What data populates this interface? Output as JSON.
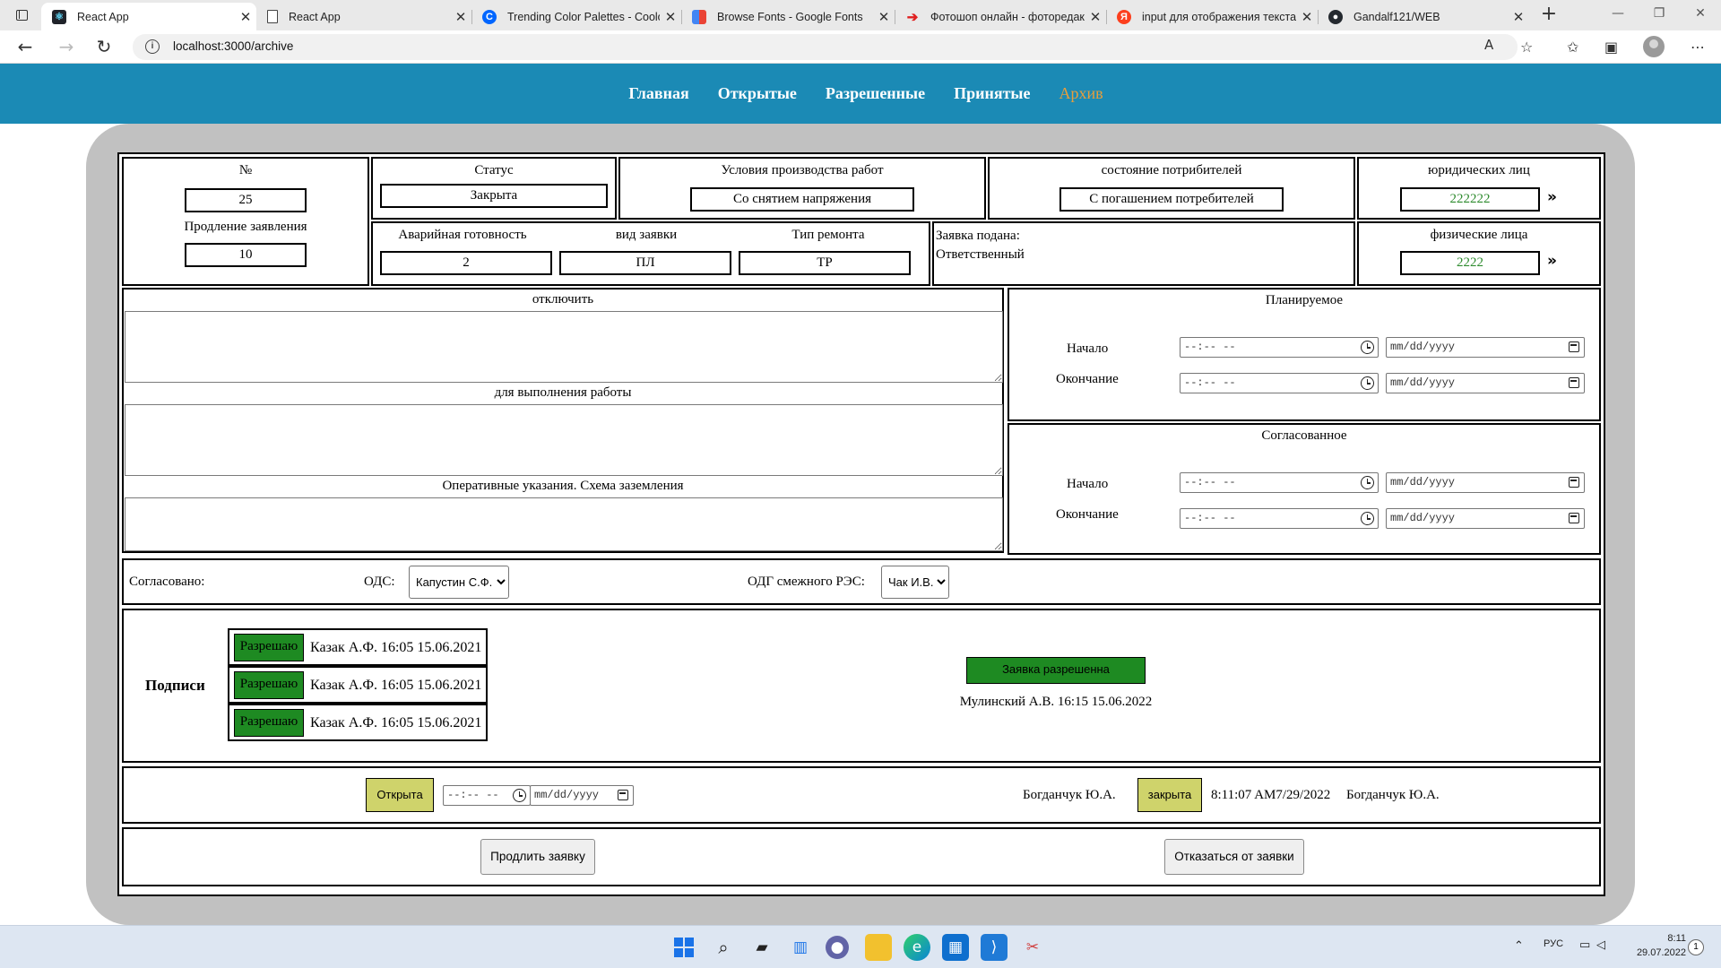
{
  "browser": {
    "tabs": [
      {
        "title": "React App",
        "icon": "react-icon",
        "active": true
      },
      {
        "title": "React App",
        "icon": "page-icon"
      },
      {
        "title": "Trending Color Palettes - Coolors",
        "icon": "coolors-icon"
      },
      {
        "title": "Browse Fonts - Google Fonts",
        "icon": "google-fonts-icon"
      },
      {
        "title": "Фотошоп онлайн - фоторедактор",
        "icon": "photoshop-online-icon"
      },
      {
        "title": "input для отображения текста",
        "icon": "yandex-icon"
      },
      {
        "title": "Gandalf121/WEB",
        "icon": "github-icon"
      }
    ],
    "url": "localhost:3000/archive"
  },
  "nav": {
    "items": [
      "Главная",
      "Открытые",
      "Разрешенные",
      "Принятые",
      "Архив"
    ],
    "active": "Архив",
    "active_color": "#e89e3c",
    "bg_color": "#1b8ab5"
  },
  "form": {
    "number": {
      "label": "№",
      "value": "25"
    },
    "extension": {
      "label": "Продление заявления",
      "value": "10"
    },
    "status": {
      "label": "Статус",
      "value": "Закрыта"
    },
    "conditions": {
      "label": "Условия производства работ",
      "value": "Со снятием напряжения"
    },
    "consumers": {
      "label": "состояние потрибителей",
      "value": "С погашением потребителей"
    },
    "legal": {
      "label": "юридических лиц",
      "value": "222222"
    },
    "physical": {
      "label": "физические лица",
      "value": "2222"
    },
    "emergency": {
      "label": "Аварийная готовность",
      "value": "2"
    },
    "request_type": {
      "label": "вид заявки",
      "value": "ПЛ"
    },
    "repair_type": {
      "label": "Тип ремонта",
      "value": "ТР"
    },
    "submitted_label": "Заявка подана:",
    "responsible_label": "Ответственный",
    "disconnect_label": "отключить",
    "work_label": "для выполнения работы",
    "instructions_label": "Оперативные указания. Схема заземления",
    "planned": {
      "title": "Планируемое",
      "start_label": "Начало",
      "end_label": "Окончание"
    },
    "agreed": {
      "title": "Согласованное",
      "start_label": "Начало",
      "end_label": "Окончание"
    },
    "time_placeholder": "--:-- --",
    "date_placeholder": "mm/dd/yyyy",
    "approved_label": "Согласовано:",
    "ods": {
      "label": "ОДС:",
      "selected": "Капустин С.Ф."
    },
    "odg": {
      "label": "ОДГ смежного РЭС:",
      "selected": "Чак И.В."
    }
  },
  "signatures": {
    "title": "Подписи",
    "items": [
      {
        "button": "Разрешаю",
        "text": "Казак А.Ф. 16:05 15.06.2021"
      },
      {
        "button": "Разрешаю",
        "text": "Казак А.Ф. 16:05 15.06.2021"
      },
      {
        "button": "Разрешаю",
        "text": "Казак А.Ф. 16:05 15.06.2021"
      }
    ],
    "approved_status": "Заявка разрешенна",
    "approver": "Мулинский А.В. 16:15 15.06.2022",
    "accent_green": "#1e8a22"
  },
  "state": {
    "open_button": "Открыта",
    "person_left": "Богданчук Ю.А.",
    "closed_button": "закрыта",
    "closed_time": "8:11:07 AM7/29/2022",
    "person_right": "Богданчук Ю.А.",
    "button_color": "#cfd36b"
  },
  "actions": {
    "extend": "Продлить заявку",
    "refuse": "Отказаться от заявки"
  },
  "taskbar": {
    "lang": "РУС",
    "time": "8:11",
    "date": "29.07.2022",
    "notifications": "1"
  }
}
